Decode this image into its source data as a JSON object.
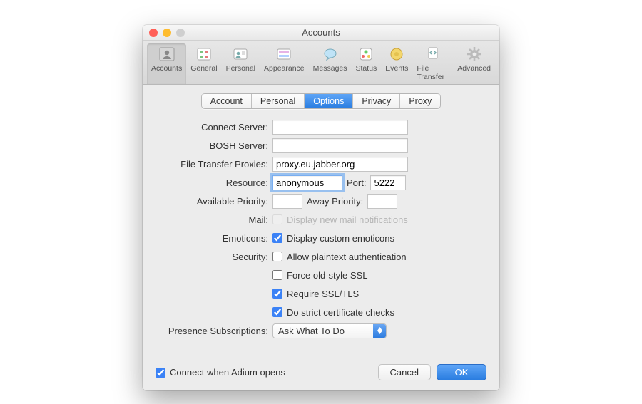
{
  "window": {
    "title": "Accounts"
  },
  "toolbar": {
    "items": [
      {
        "label": "Accounts"
      },
      {
        "label": "General"
      },
      {
        "label": "Personal"
      },
      {
        "label": "Appearance"
      },
      {
        "label": "Messages"
      },
      {
        "label": "Status"
      },
      {
        "label": "Events"
      },
      {
        "label": "File Transfer"
      },
      {
        "label": "Advanced"
      }
    ]
  },
  "tabs": {
    "items": [
      "Account",
      "Personal",
      "Options",
      "Privacy",
      "Proxy"
    ],
    "selected": "Options"
  },
  "fields": {
    "connect_server": {
      "label": "Connect Server:",
      "value": ""
    },
    "bosh_server": {
      "label": "BOSH Server:",
      "value": ""
    },
    "file_transfer_proxies": {
      "label": "File Transfer Proxies:",
      "value": "proxy.eu.jabber.org"
    },
    "resource": {
      "label": "Resource:",
      "value": "anonymous"
    },
    "port": {
      "label": "Port:",
      "value": "5222"
    },
    "available_priority": {
      "label": "Available Priority:",
      "value": ""
    },
    "away_priority": {
      "label": "Away Priority:",
      "value": ""
    },
    "mail": {
      "label": "Mail:",
      "option": "Display new mail notifications"
    },
    "emoticons": {
      "label": "Emoticons:",
      "option": "Display custom emoticons"
    },
    "security": {
      "label": "Security:",
      "allow_plaintext": "Allow plaintext authentication",
      "force_old_ssl": "Force old-style SSL",
      "require_ssl": "Require SSL/TLS",
      "strict_cert": "Do strict certificate checks"
    },
    "presence_subscriptions": {
      "label": "Presence Subscriptions:",
      "value": "Ask What To Do"
    }
  },
  "footer": {
    "connect_on_open": "Connect when Adium opens",
    "cancel": "Cancel",
    "ok": "OK"
  }
}
